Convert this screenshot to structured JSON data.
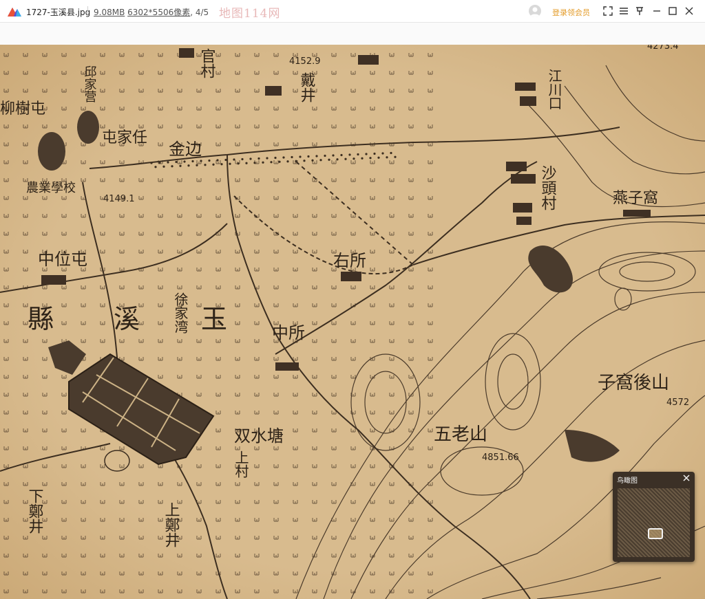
{
  "titlebar": {
    "file_name": "1727-玉溪县.jpg",
    "file_size": "9.08MB",
    "dimensions": "6302*5506像素",
    "page_index": "4/5",
    "watermark": "地图114网",
    "member_label": "登录领会员"
  },
  "icons": {
    "logo": "mountain-logo-icon",
    "avatar": "user-avatar-icon",
    "fullscreen": "fullscreen-icon",
    "menu": "menu-icon",
    "pin": "pin-icon",
    "minimize": "minimize-icon",
    "maximize": "maximize-icon",
    "close": "close-icon"
  },
  "map": {
    "labels": [
      {
        "text": "中位屯"
      },
      {
        "text": "屯家任"
      },
      {
        "text": "柳樹屯"
      },
      {
        "text": "邱家营"
      },
      {
        "text": "官村"
      },
      {
        "text": "戴井"
      },
      {
        "text": "金边"
      },
      {
        "text": "農業學校"
      },
      {
        "text": "縣"
      },
      {
        "text": "溪"
      },
      {
        "text": "玉"
      },
      {
        "text": "徐家湾"
      },
      {
        "text": "右所"
      },
      {
        "text": "中所"
      },
      {
        "text": "沙頭村"
      },
      {
        "text": "燕子窩"
      },
      {
        "text": "子窩後山"
      },
      {
        "text": "五老山"
      },
      {
        "text": "双水塘"
      },
      {
        "text": "上村"
      },
      {
        "text": "下鄭井"
      },
      {
        "text": "上鄭井"
      },
      {
        "text": "江川口"
      }
    ],
    "elevations": [
      {
        "text": "4152.9"
      },
      {
        "text": "4149.1"
      },
      {
        "text": "4851.66"
      },
      {
        "text": "4572"
      },
      {
        "text": "4273.4"
      }
    ]
  },
  "minimap": {
    "title": "鸟瞰图"
  },
  "colors": {
    "paper": "#d6b98c",
    "ink": "#4a3a2a",
    "watermark": "#e8b8b8",
    "member": "#e39b28",
    "minimap_bg": "#3b3026"
  }
}
